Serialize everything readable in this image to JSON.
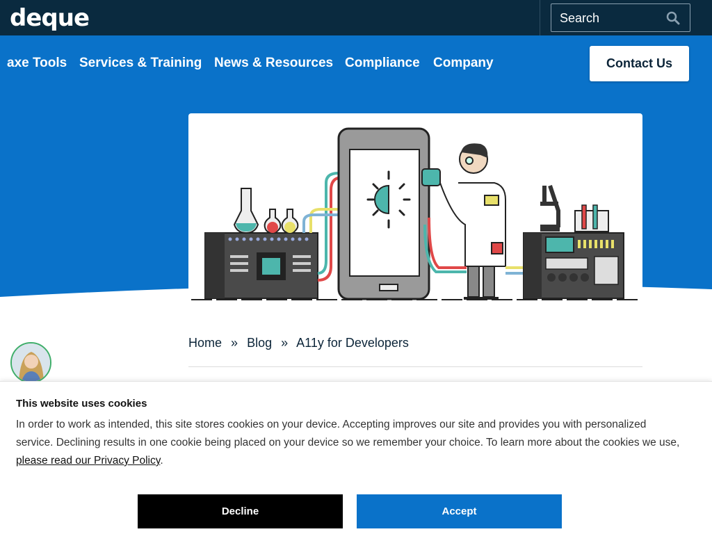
{
  "header": {
    "logo_text": "deque",
    "search_label": "Search"
  },
  "nav": {
    "items": [
      "axe Tools",
      "Services & Training",
      "News & Resources",
      "Compliance",
      "Company"
    ],
    "contact_label": "Contact Us"
  },
  "colors": {
    "topbar": "#0a2a3f",
    "brand_blue": "#0a72c9",
    "white": "#ffffff"
  },
  "breadcrumb": {
    "items": [
      "Home",
      "Blog",
      "A11y for Developers"
    ],
    "separator": "»"
  },
  "cookie_banner": {
    "title": "This website uses cookies",
    "body": "In order to work as intended, this site stores cookies on your device. Accepting improves our site and provides you with personalized service. Declining results in one cookie being placed on your device so we remember your choice. To learn more about the cookies we use,",
    "link_text": "please read our Privacy Policy",
    "link_suffix": ".",
    "decline_label": "Decline",
    "accept_label": "Accept"
  },
  "icons": {
    "search": "search-icon",
    "avatar": "author-avatar"
  }
}
